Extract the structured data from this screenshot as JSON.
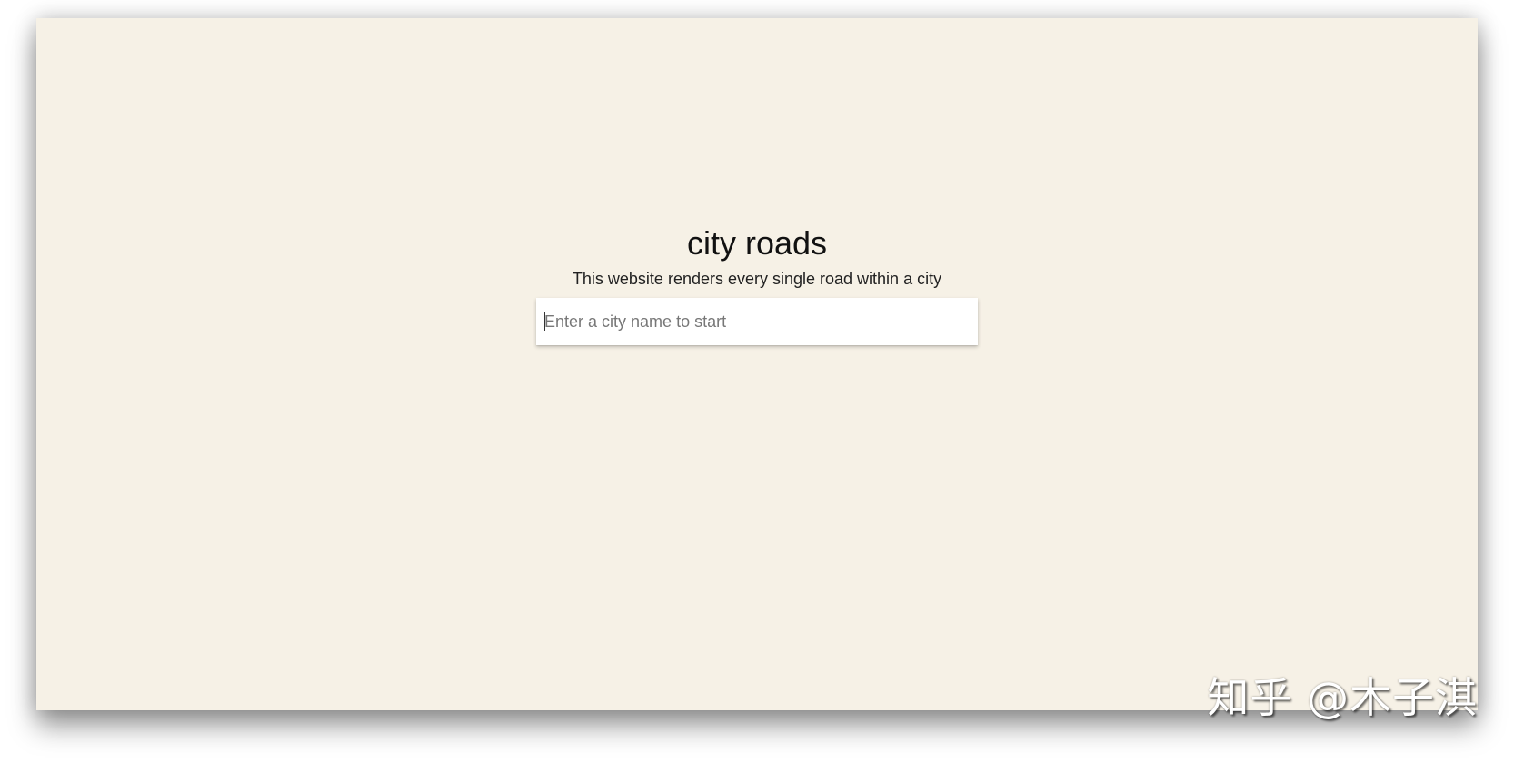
{
  "app": {
    "title": "city roads",
    "subtitle": "This website renders every single road within a city"
  },
  "search": {
    "placeholder": "Enter a city name to start",
    "value": ""
  },
  "watermark": {
    "text": "知乎 @木子淇"
  },
  "colors": {
    "background": "#f6f1e6",
    "input_background": "#ffffff",
    "title_text": "#111111"
  }
}
